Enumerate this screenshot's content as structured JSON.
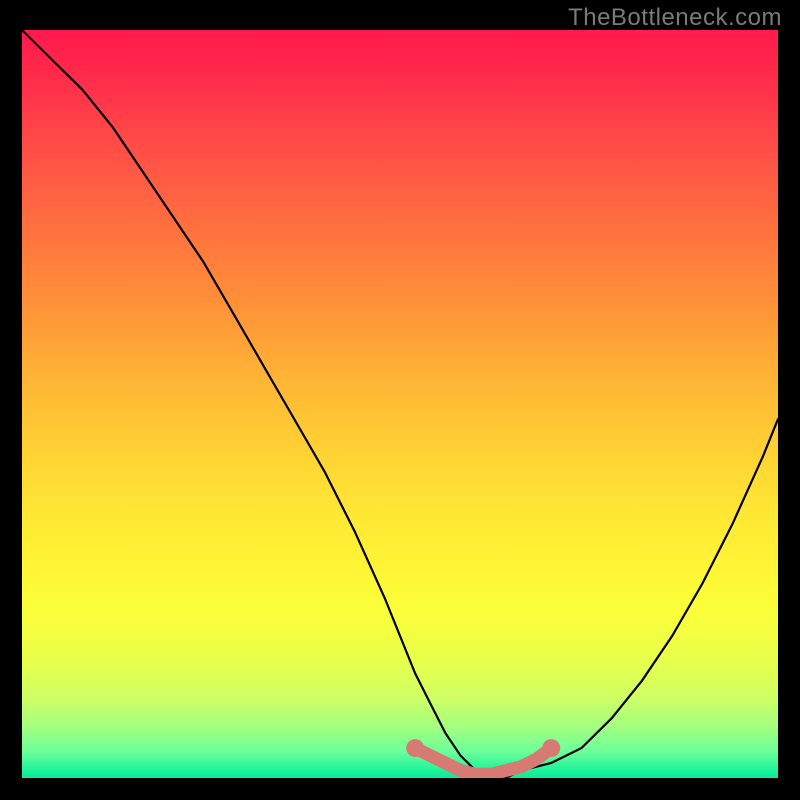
{
  "watermark": "TheBottleneck.com",
  "chart_data": {
    "type": "line",
    "title": "",
    "xlabel": "",
    "ylabel": "",
    "xlim": [
      0,
      100
    ],
    "ylim": [
      0,
      100
    ],
    "grid": false,
    "legend": false,
    "background_gradient": {
      "top": "#ff1a4d",
      "mid": "#ffe634",
      "bottom": "#10e79c"
    },
    "series": [
      {
        "name": "bottleneck-curve",
        "color": "#000000",
        "x": [
          0,
          4,
          8,
          12,
          16,
          20,
          24,
          28,
          32,
          36,
          40,
          44,
          48,
          50,
          52,
          54,
          56,
          58,
          60,
          62,
          64,
          66,
          70,
          74,
          78,
          82,
          86,
          90,
          94,
          98,
          100
        ],
        "values": [
          100,
          96,
          92,
          87,
          81,
          75,
          69,
          62,
          55,
          48,
          41,
          33,
          24,
          19,
          14,
          10,
          6,
          3,
          1,
          0,
          0,
          1,
          2,
          4,
          8,
          13,
          19,
          26,
          34,
          43,
          48
        ]
      },
      {
        "name": "optimal-range-highlight",
        "color": "#d77a74",
        "x": [
          52,
          54,
          56,
          58,
          60,
          62,
          64,
          66,
          68,
          70
        ],
        "values": [
          4,
          3,
          2,
          1,
          0.5,
          0.5,
          1,
          1.5,
          2.5,
          4
        ]
      }
    ],
    "annotations": []
  }
}
